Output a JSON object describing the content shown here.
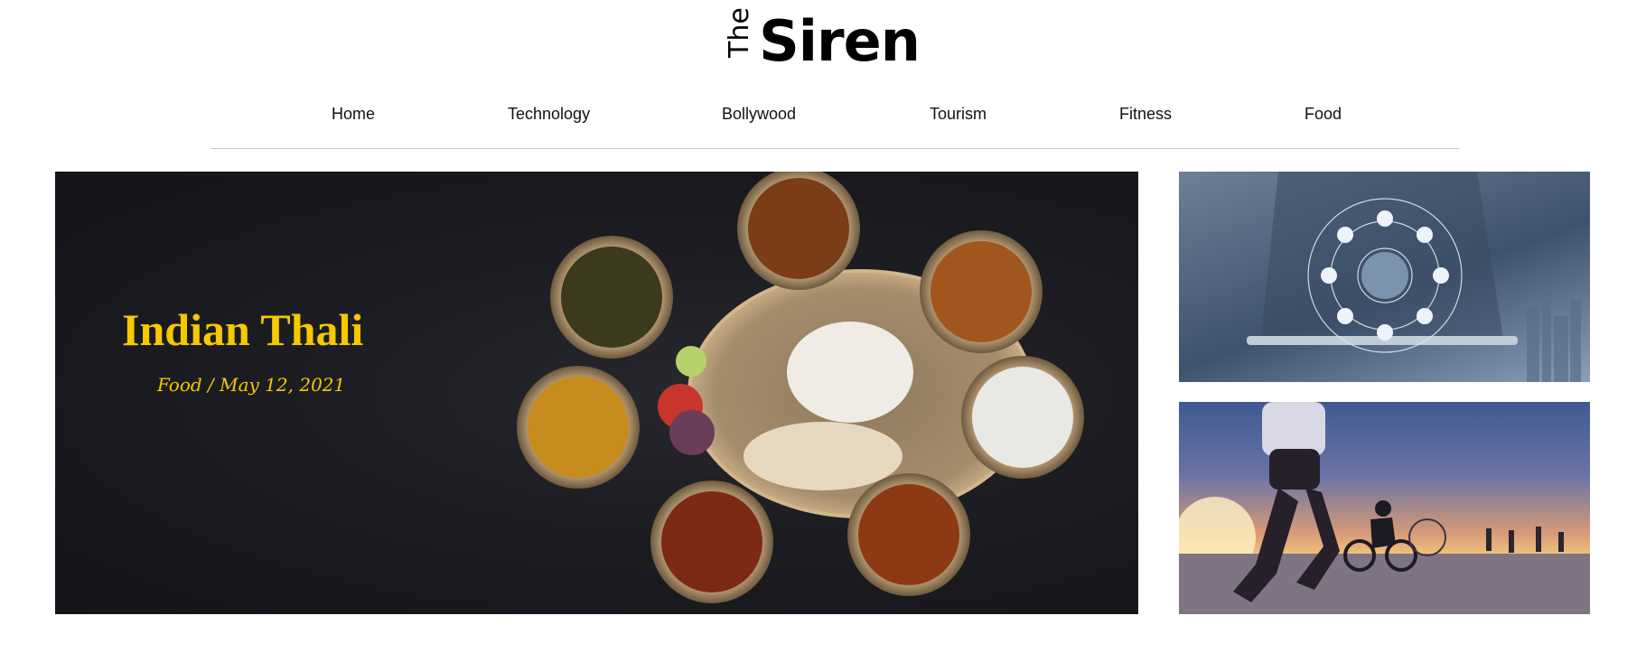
{
  "site": {
    "logo_small": "The",
    "logo_big": "Siren"
  },
  "nav": {
    "items": [
      {
        "label": "Home"
      },
      {
        "label": "Technology"
      },
      {
        "label": "Bollywood"
      },
      {
        "label": "Tourism"
      },
      {
        "label": "Fitness"
      },
      {
        "label": "Food"
      }
    ]
  },
  "hero": {
    "title": "Indian Thali",
    "meta": "Food / May 12, 2021",
    "image": "indian-thali-photo",
    "accent_color": "#f5c800"
  },
  "side_cards": [
    {
      "image": "technology-network-photo"
    },
    {
      "image": "fitness-running-cycling-photo"
    }
  ]
}
